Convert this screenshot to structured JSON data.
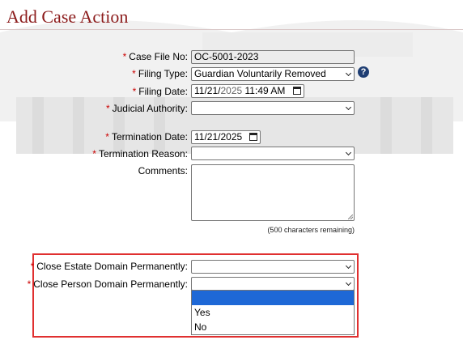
{
  "page": {
    "title": "Add Case Action"
  },
  "form": {
    "case_file_no": {
      "label": "Case File No:",
      "value": "OC-5001-2023"
    },
    "filing_type": {
      "label": "Filing Type:",
      "value": "Guardian Voluntarily Removed"
    },
    "filing_date": {
      "label": "Filing Date:",
      "value_date": "11/21/",
      "value_year": "2025",
      "value_time": " 11:49  AM"
    },
    "judicial_authority": {
      "label": "Judicial Authority:",
      "value": ""
    },
    "termination_date": {
      "label": "Termination Date:",
      "value": "11/21/2025"
    },
    "termination_reason": {
      "label": "Termination Reason:",
      "value": ""
    },
    "comments": {
      "label": "Comments:",
      "value": "",
      "remaining_text": "(500 characters remaining)"
    },
    "close_estate": {
      "label": "Close Estate Domain Permanently:",
      "value": ""
    },
    "close_person": {
      "label": "Close Person Domain Permanently:",
      "value": "",
      "options": [
        "",
        "Yes",
        "No"
      ],
      "highlighted_option": 0
    }
  },
  "required_marker": "*",
  "help_icon_glyph": "?",
  "colors": {
    "title": "#8b1a1a",
    "required": "#cc0000",
    "highlight_box": "#e03030",
    "option_selected": "#1e68d6",
    "help_icon": "#1f3e73"
  }
}
